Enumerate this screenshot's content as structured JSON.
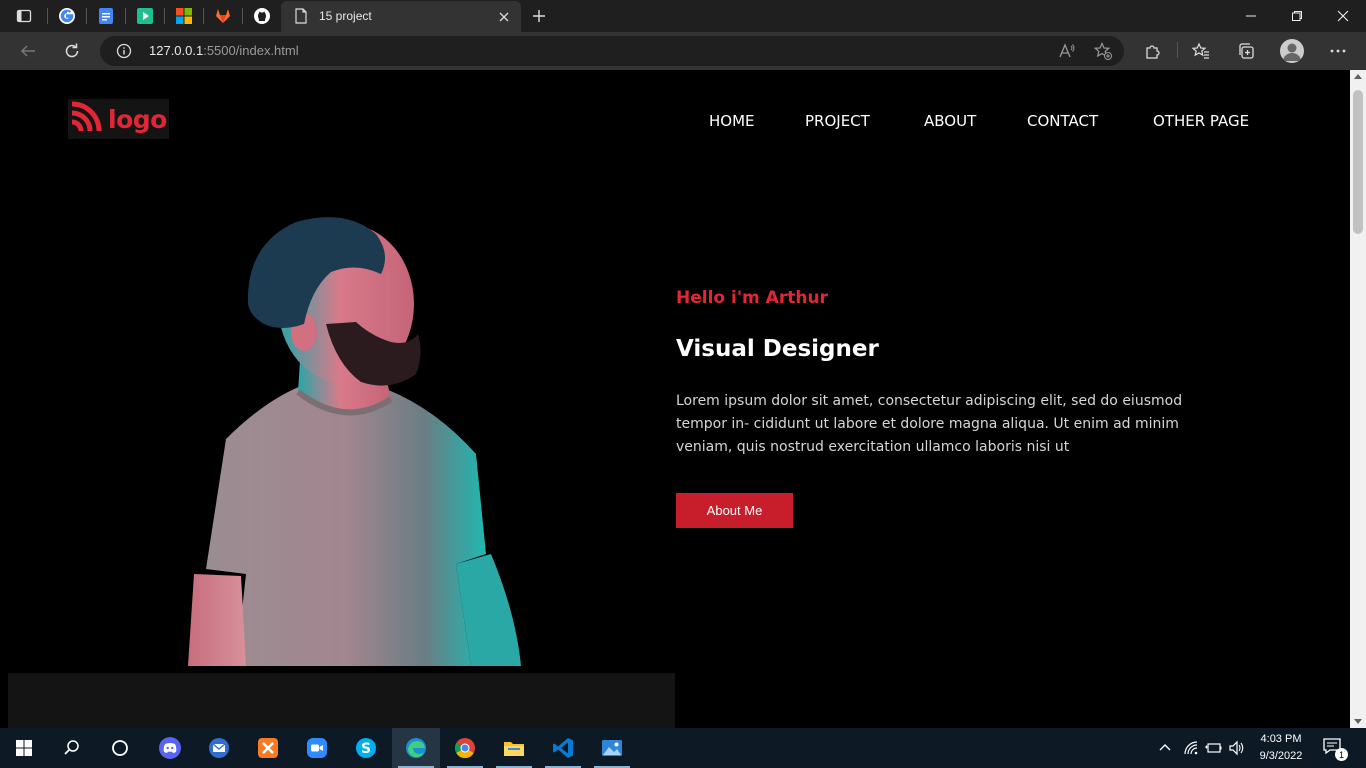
{
  "browser": {
    "active_tab_title": "15 project",
    "url_host": "127.0.0.1",
    "url_rest": ":5500/index.html"
  },
  "site": {
    "logo_text": "logo",
    "nav": [
      "HOME",
      "PROJECT",
      "ABOUT",
      "CONTACT",
      "OTHER PAGE"
    ],
    "greeting": "Hello i'm Arthur",
    "role": "Visual Designer",
    "description": "Lorem ipsum dolor sit amet, consectetur adipiscing elit, sed do eiusmod tempor in- cididunt ut labore et dolore magna aliqua. Ut enim ad minim veniam, quis nostrud exercitation ullamco laboris nisi ut",
    "cta_label": "About Me"
  },
  "taskbar": {
    "time": "4:03 PM",
    "date": "9/3/2022",
    "notification_count": "1"
  },
  "colors": {
    "accent": "#e32636",
    "button": "#c81e2b",
    "background": "#000000",
    "panel": "#141414"
  }
}
